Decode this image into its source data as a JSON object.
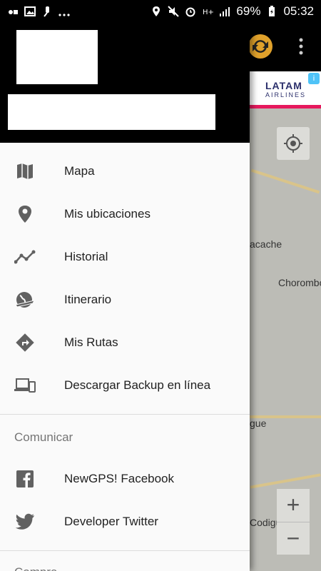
{
  "status_bar": {
    "battery": "69%",
    "time": "05:32",
    "left_icons": [
      "recording-icon",
      "gallery-icon",
      "mic-icon",
      "more-dots-icon"
    ],
    "right_icons": [
      "location-icon",
      "mute-icon",
      "alarm-icon",
      "hplus-icon",
      "signal-icon",
      "battery-icon"
    ]
  },
  "background": {
    "ad": {
      "brand": "LATAM",
      "sub": "AIRLINES"
    },
    "map_labels": [
      "acache",
      "Chorombo",
      "gue",
      "Codigua"
    ],
    "zoom_in": "+",
    "zoom_out": "−"
  },
  "drawer": {
    "items": [
      {
        "label": "Mapa",
        "icon": "map-icon"
      },
      {
        "label": "Mis ubicaciones",
        "icon": "location-pin-icon"
      },
      {
        "label": "Historial",
        "icon": "history-line-icon"
      },
      {
        "label": "Itinerario",
        "icon": "globe-plane-icon"
      },
      {
        "label": "Mis Rutas",
        "icon": "route-sign-icon"
      },
      {
        "label": "Descargar Backup en línea",
        "icon": "devices-icon"
      }
    ],
    "section_communicate": "Comunicar",
    "social": [
      {
        "label": "NewGPS! Facebook",
        "icon": "facebook-icon"
      },
      {
        "label": "Developer Twitter",
        "icon": "twitter-icon"
      }
    ],
    "section_next": "Compra"
  },
  "colors": {
    "drawer_bg": "#fafafa",
    "header_bg": "#000000",
    "icon": "#616161",
    "accent_ad": "#e6195d"
  }
}
